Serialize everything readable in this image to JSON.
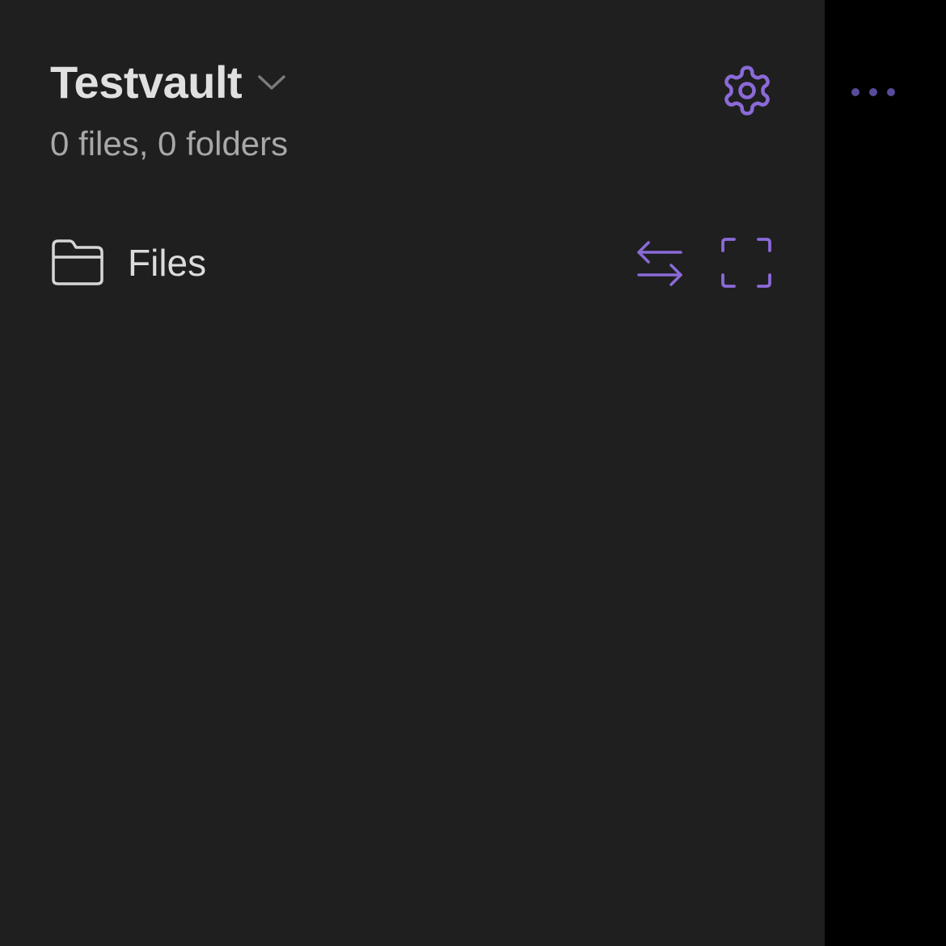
{
  "vault": {
    "name": "Testvault",
    "stats": "0 files, 0 folders",
    "switcher_icon": "chevron-down-icon"
  },
  "header": {
    "settings_icon": "gear-icon",
    "more_icon": "more-horizontal-icon"
  },
  "files_section": {
    "label": "Files",
    "icon": "folder-icon",
    "actions": [
      {
        "icon": "swap-arrows-icon"
      },
      {
        "icon": "expand-frame-icon"
      }
    ]
  },
  "colors": {
    "accent": "#8b6ad8",
    "accent_dim": "#5a4a9a",
    "sidebar_bg": "#1f1f1f",
    "panel_bg": "#000000",
    "title_text": "#e0e0e0",
    "muted_text": "#a8a8a8"
  }
}
